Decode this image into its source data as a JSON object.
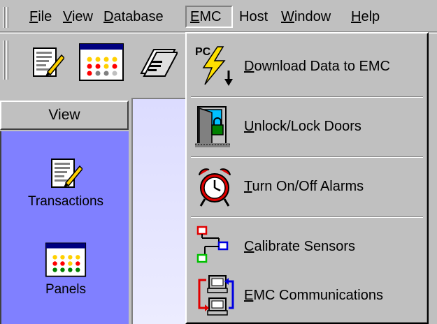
{
  "menubar": {
    "items": [
      {
        "label": "File"
      },
      {
        "label": "View"
      },
      {
        "label": "Database"
      },
      {
        "label": "EMC"
      },
      {
        "label": "Host"
      },
      {
        "label": "Window"
      },
      {
        "label": "Help"
      }
    ]
  },
  "toolbar": {
    "buttons": [
      {
        "icon": "transactions-icon"
      },
      {
        "icon": "panels-icon"
      },
      {
        "icon": "cards-icon"
      }
    ]
  },
  "sidebar": {
    "header": "View",
    "items": [
      {
        "label": "Transactions",
        "icon": "transactions-icon"
      },
      {
        "label": "Panels",
        "icon": "panels-icon"
      }
    ]
  },
  "emc_menu": {
    "items": [
      {
        "label": "Download Data to EMC",
        "icon": "download-lightning-icon"
      },
      {
        "label": "Unlock/Lock Doors",
        "icon": "door-lock-icon"
      },
      {
        "label": "Turn On/Off Alarms",
        "icon": "alarm-clock-icon"
      },
      {
        "label": "Calibrate Sensors",
        "icon": "sensors-icon"
      },
      {
        "label": "EMC Communications",
        "icon": "computers-communication-icon"
      }
    ]
  },
  "colors": {
    "chrome": "#c0c0c0",
    "sidebar_panel": "#8080ff",
    "content_bg": "#e6e6ff"
  }
}
